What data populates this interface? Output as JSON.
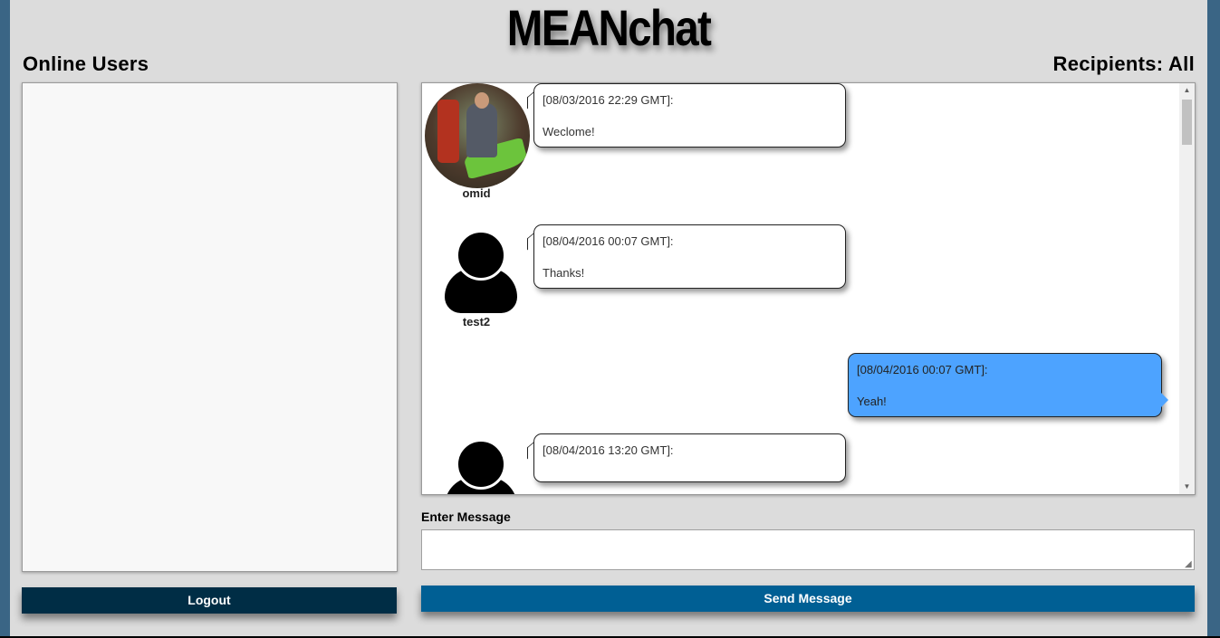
{
  "app": {
    "title": "MEANchat"
  },
  "online_users": {
    "heading": "Online Users",
    "users": []
  },
  "recipients": {
    "label": "Recipients: All"
  },
  "messages": [
    {
      "user": "omid",
      "avatar": "user-photo",
      "timestamp": "[08/03/2016 22:29 GMT]:",
      "text": "Weclome!",
      "mine": false
    },
    {
      "user": "test2",
      "avatar": "default-user-icon",
      "timestamp": "[08/04/2016 00:07 GMT]:",
      "text": "Thanks!",
      "mine": false
    },
    {
      "user": "",
      "avatar": "",
      "timestamp": "[08/04/2016 00:07 GMT]:",
      "text": "Yeah!",
      "mine": true
    },
    {
      "user": "",
      "avatar": "default-user-icon",
      "timestamp": "[08/04/2016 13:20 GMT]:",
      "text": "",
      "mine": false
    }
  ],
  "composer": {
    "label": "Enter Message",
    "value": "",
    "send_label": "Send Message"
  },
  "actions": {
    "logout_label": "Logout"
  },
  "colors": {
    "background": "#3a6585",
    "panel": "#dcdcdc",
    "logout": "#002d45",
    "send": "#005f94",
    "own_bubble": "#4da3ff"
  }
}
